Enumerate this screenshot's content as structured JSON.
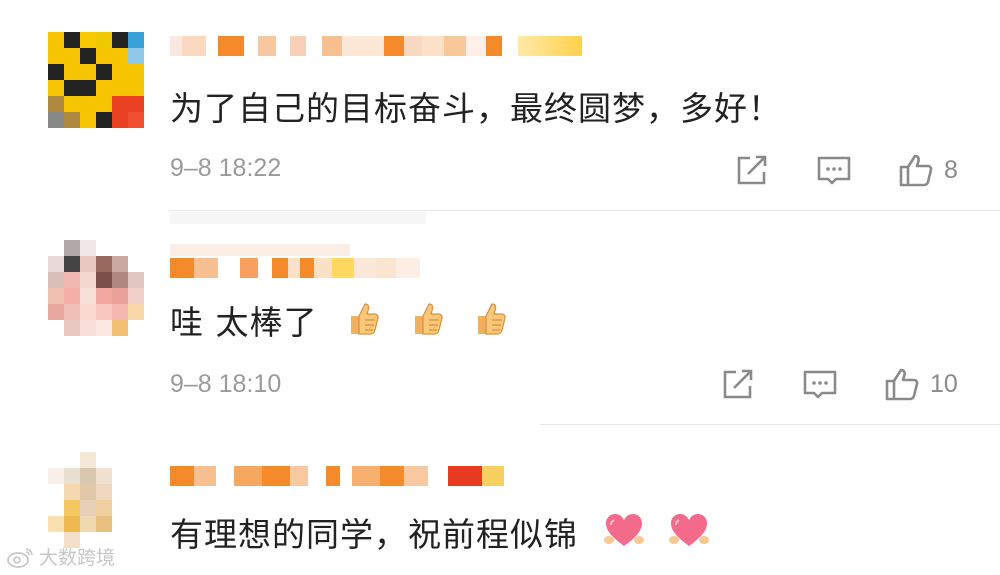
{
  "comments": [
    {
      "text": "为了自己的目标奋斗，最终圆梦，多好！",
      "time": "9–8 18:22",
      "likes": "8",
      "icons": [
        "share-icon",
        "comment-icon",
        "like-icon"
      ]
    },
    {
      "text": "哇 太棒了",
      "emoji": "thumbs-up-icon",
      "time": "9–8 18:10",
      "likes": "10",
      "icons": [
        "share-icon",
        "comment-icon",
        "like-icon"
      ]
    },
    {
      "text": "有理想的同学，祝前程似锦",
      "emoji": "heart-hands-icon"
    }
  ],
  "watermark": {
    "text": "大数跨境",
    "icon": "weibo-logo-icon"
  },
  "colors": {
    "text": "#222222",
    "meta": "#9a9a9a",
    "divider": "#e8e8e8"
  }
}
